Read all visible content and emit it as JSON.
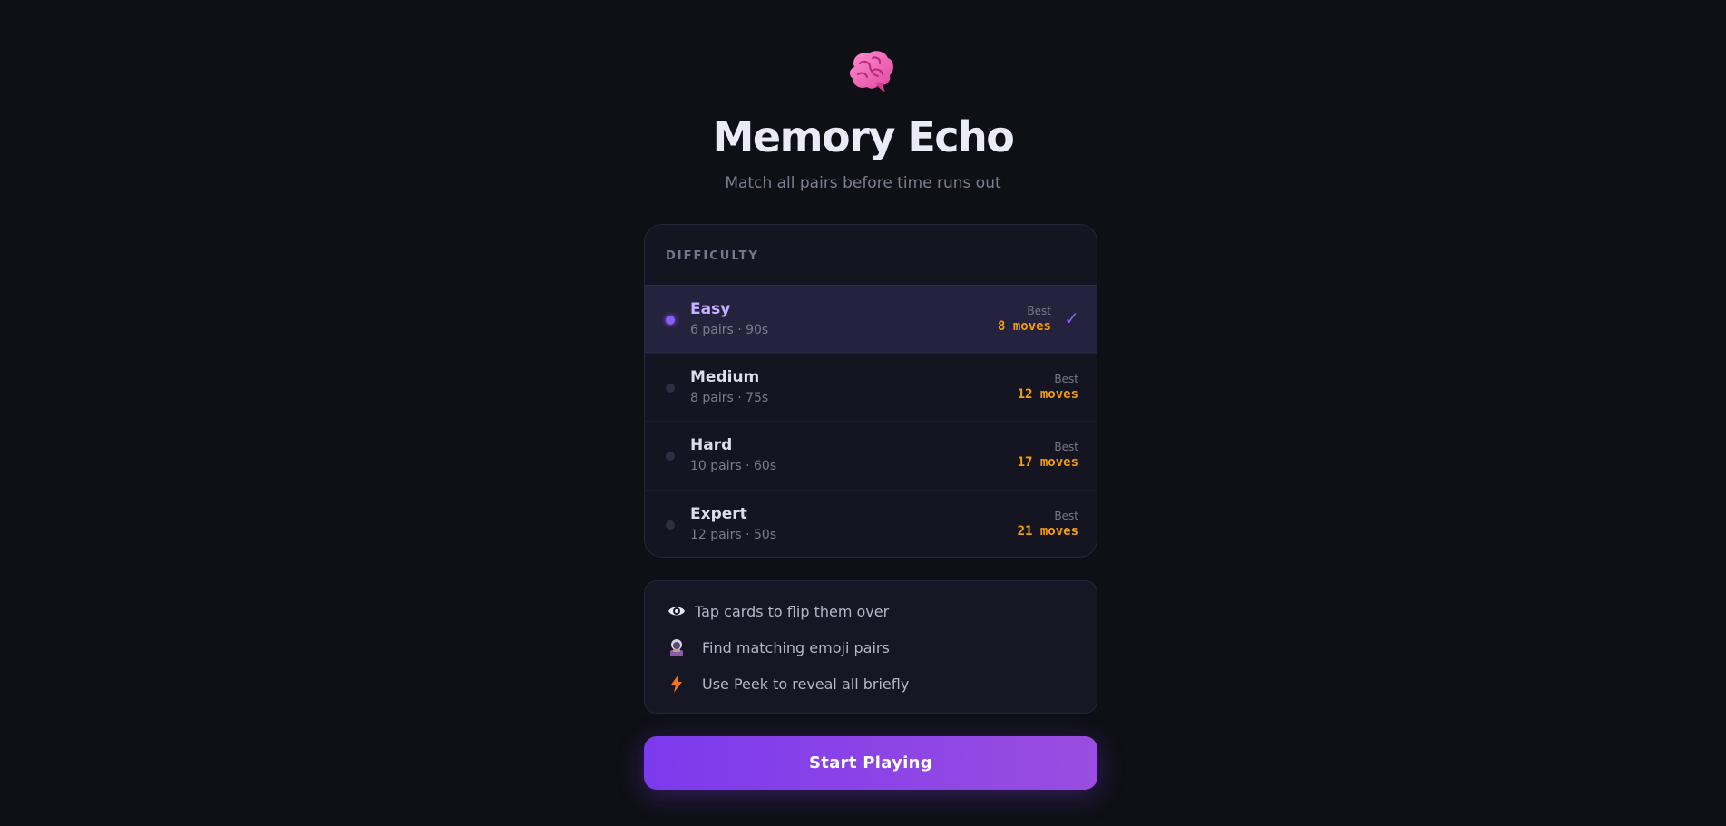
{
  "app": {
    "title": "Memory Echo",
    "subtitle": "Match all pairs before time runs out",
    "logo_icon": "brain-icon"
  },
  "difficulty": {
    "label": "DIFFICULTY",
    "selected": "Easy",
    "best_label": "Best",
    "options": [
      {
        "name": "Easy",
        "meta": "6 pairs · 90s",
        "best": "8 moves",
        "selected": true
      },
      {
        "name": "Medium",
        "meta": "8 pairs · 75s",
        "best": "12 moves",
        "selected": false
      },
      {
        "name": "Hard",
        "meta": "10 pairs · 60s",
        "best": "17 moves",
        "selected": false
      },
      {
        "name": "Expert",
        "meta": "12 pairs · 50s",
        "best": "21 moves",
        "selected": false
      }
    ],
    "check_glyph": "✓"
  },
  "tips": [
    {
      "icon": "eye-icon",
      "text": "Tap cards to flip them over"
    },
    {
      "icon": "fortune-teller-icon",
      "text": "Find matching emoji pairs"
    },
    {
      "icon": "lightning-icon",
      "text": "Use Peek to reveal all briefly"
    }
  ],
  "start_button": {
    "label": "Start Playing"
  },
  "colors": {
    "background": "#0f1016",
    "accent": "#8b5cf6",
    "best_moves": "#f59e0b",
    "button_start": "#7c3aed",
    "button_end": "#9a4de0"
  }
}
